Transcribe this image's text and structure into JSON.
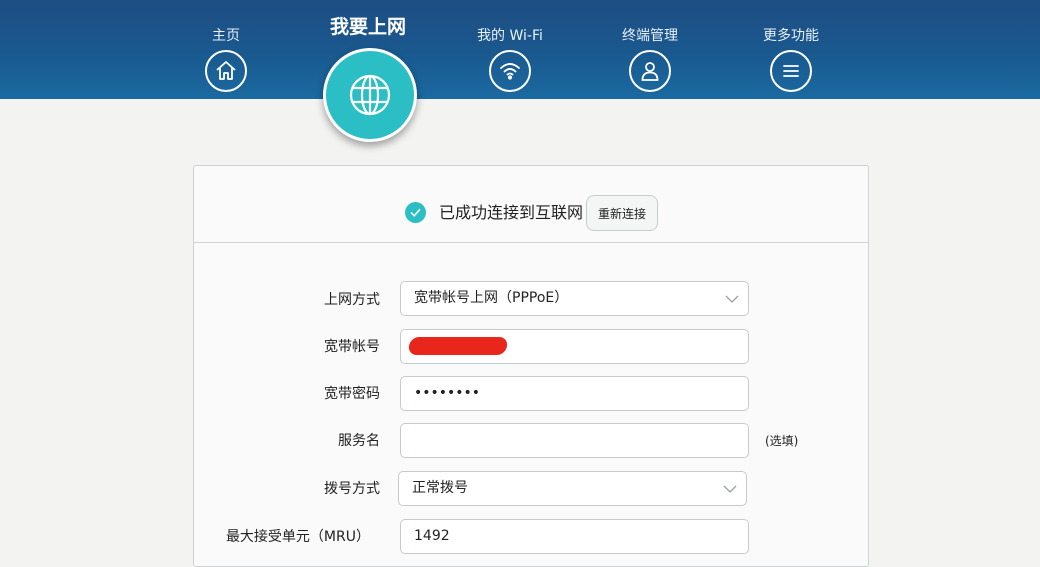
{
  "nav": {
    "items": [
      {
        "label": "主页",
        "icon": "home-icon"
      },
      {
        "label": "我的 Wi-Fi",
        "icon": "wifi-icon"
      },
      {
        "label": "终端管理",
        "icon": "user-icon"
      },
      {
        "label": "更多功能",
        "icon": "menu-icon"
      }
    ],
    "active": {
      "label": "我要上网",
      "icon": "globe-icon"
    }
  },
  "status": {
    "text": "已成功连接到互联网",
    "reconnect_label": "重新连接"
  },
  "form": {
    "mode": {
      "label": "上网方式",
      "value": "宽带帐号上网（PPPoE）"
    },
    "account": {
      "label": "宽带帐号",
      "value": ""
    },
    "password": {
      "label": "宽带密码",
      "value": "••••••••"
    },
    "service": {
      "label": "服务名",
      "value": "",
      "hint": "(选填)"
    },
    "dial": {
      "label": "拨号方式",
      "value": "正常拨号"
    },
    "mtu": {
      "label": "最大接受单元（MRU）",
      "value": "1492"
    }
  },
  "colors": {
    "topbar": "#1a5a90",
    "accent": "#2bbfc5"
  }
}
